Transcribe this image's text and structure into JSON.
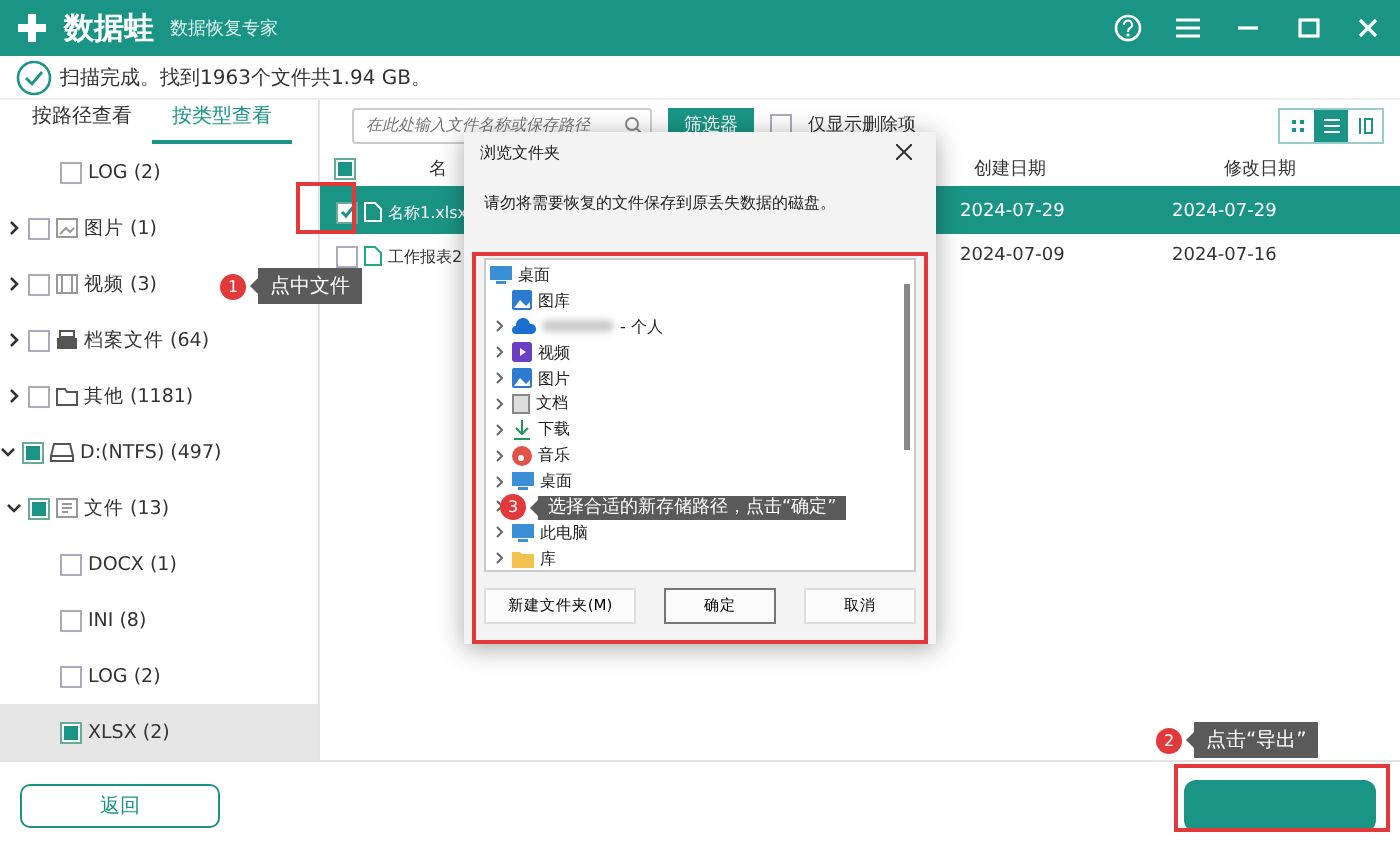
{
  "app": {
    "name": "数据蛙",
    "subtitle": "数据恢复专家"
  },
  "status": "扫描完成。找到1963个文件共1.94 GB。",
  "view_tabs": [
    {
      "label": "按路径查看",
      "selected": false
    },
    {
      "label": "按类型查看",
      "selected": true
    }
  ],
  "search": {
    "placeholder": "在此处输入文件名称或保存路径"
  },
  "filter_button": "筛选器",
  "deleted_only": {
    "label": "仅显示删除项",
    "checked": false
  },
  "view_modes": [
    {
      "kind": "grid",
      "selected": false
    },
    {
      "kind": "list",
      "selected": true
    },
    {
      "kind": "columns",
      "selected": false
    }
  ],
  "tree": [
    {
      "children": [
        {
          "children": [
            {
              "label": "LOG (2)",
              "checked": false,
              "selected": false
            }
          ]
        },
        {
          "label": "图片 (1)",
          "kind": "image",
          "checked": false,
          "expanded": false,
          "selected": false
        },
        {
          "label": "视频 (3)",
          "kind": "video",
          "checked": false,
          "expanded": false,
          "selected": false
        },
        {
          "label": "档案文件 (64)",
          "kind": "archive",
          "checked": false,
          "expanded": false,
          "selected": false
        },
        {
          "label": "其他 (1181)",
          "kind": "folder",
          "checked": false,
          "expanded": false,
          "selected": false
        }
      ]
    },
    {
      "label": "D:(NTFS) (497)",
      "kind": "drive",
      "checked": true,
      "expanded": true,
      "selected": false,
      "children": [
        {
          "label": "文件 (13)",
          "kind": "document",
          "checked": true,
          "expanded": true,
          "selected": false,
          "children": [
            {
              "label": "DOCX (1)",
              "checked": false,
              "selected": false
            },
            {
              "label": "INI (8)",
              "checked": false,
              "selected": false
            },
            {
              "label": "LOG (2)",
              "checked": false,
              "selected": false
            },
            {
              "label": "XLSX (2)",
              "checked": true,
              "selected": true
            }
          ]
        }
      ]
    }
  ],
  "table": {
    "select_all": {
      "checked": true
    },
    "columns": [
      "名",
      "创建日期",
      "修改日期"
    ],
    "rows": [
      {
        "name": "名称1.xlsx",
        "created": "2024-07-29",
        "modified": "2024-07-29",
        "checked": true,
        "selected": true
      },
      {
        "name": "工作报表2",
        "created": "2024-07-09",
        "modified": "2024-07-16",
        "checked": false,
        "selected": false
      }
    ]
  },
  "dialog": {
    "title": "浏览文件夹",
    "message": "请勿将需要恢复的文件保存到原丢失数据的磁盘。",
    "folders": [
      {
        "label": "桌面",
        "kind": "desktop",
        "expandable": false
      },
      {
        "label": "图库",
        "kind": "gallery",
        "expandable": false
      },
      {
        "label": "- 个人",
        "kind": "cloud",
        "expandable": true
      },
      {
        "label": "视频",
        "kind": "video",
        "expandable": true
      },
      {
        "label": "图片",
        "kind": "gallery",
        "expandable": true
      },
      {
        "label": "文档",
        "kind": "doc",
        "expandable": true
      },
      {
        "label": "下载",
        "kind": "download",
        "expandable": true
      },
      {
        "label": "音乐",
        "kind": "music",
        "expandable": true
      },
      {
        "label": "桌面",
        "kind": "desktop",
        "expandable": true
      },
      {
        "kind": "hidden",
        "expandable": true
      },
      {
        "label": "此电脑",
        "kind": "desktop",
        "expandable": true
      },
      {
        "label": "库",
        "kind": "folder",
        "expandable": true
      }
    ],
    "buttons": [
      {
        "label": "新建文件夹(M)",
        "default": false
      },
      {
        "label": "确定",
        "default": true
      },
      {
        "label": "取消",
        "default": false
      }
    ]
  },
  "back_button": "返回",
  "callouts": [
    {
      "kind": "file",
      "number": "1",
      "text": "点中文件"
    },
    {
      "kind": "export",
      "number": "2",
      "text": "点击“导出”"
    },
    {
      "kind": "path",
      "number": "3",
      "text": "选择合适的新存储路径，点击“确定”"
    }
  ]
}
